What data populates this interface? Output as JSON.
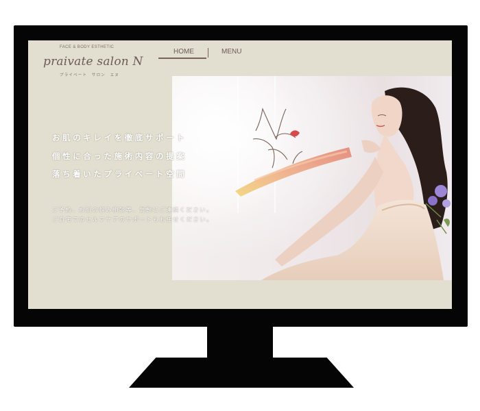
{
  "site": {
    "tagline": "FACE & BODY ESTHETIC",
    "name": "praivate salon N",
    "kana": "プライベート　サロン　エヌ"
  },
  "nav": {
    "items": [
      {
        "label": "HOME",
        "active": true
      },
      {
        "label": "MENU",
        "active": false
      }
    ]
  },
  "hero": {
    "headlines": [
      "お肌のキレイを徹底サポート",
      "個性に合った施術内容の提案",
      "落ち着いたプライベート空間"
    ],
    "notes": [
      "ご予約、お肌の悩み相談等、気軽にご連絡ください。",
      "ご自宅でのセルフケアのサポートもお任せください。"
    ]
  },
  "colors": {
    "screen_bg": "#e2dfd0",
    "bezel": "#050505",
    "accent": "#7a6258",
    "brush": "#e49a80"
  }
}
